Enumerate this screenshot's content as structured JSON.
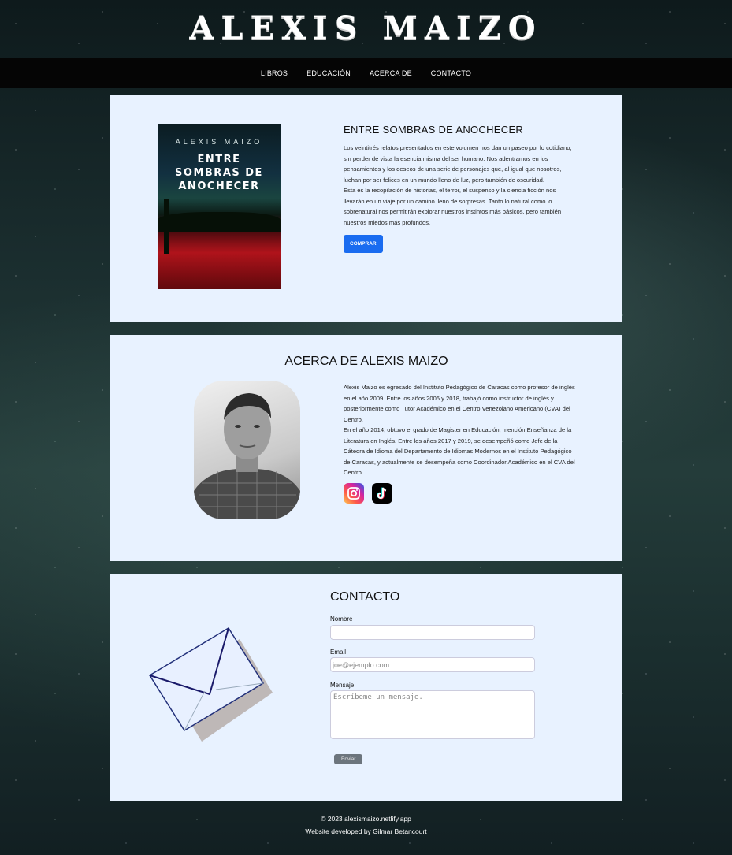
{
  "header": {
    "title": "ALEXIS MAIZO"
  },
  "nav": {
    "items": [
      "LIBROS",
      "EDUCACIÓN",
      "ACERCA DE",
      "CONTACTO"
    ]
  },
  "book": {
    "cover_author": "ALEXIS MAIZO",
    "cover_title": "ENTRE SOMBRAS DE ANOCHECER",
    "heading": "ENTRE SOMBRAS DE ANOCHECER",
    "paragraph1": "Los veintitrés relatos presentados en este volumen nos dan un paseo por lo cotidiano, sin perder de vista la esencia misma del ser humano. Nos adentramos en los pensamientos y los deseos de una serie de personajes que, al igual que nosotros, luchan por ser felices en un mundo lleno de luz, pero también de oscuridad.",
    "paragraph2": "Esta es la recopilación de historias, el terror, el suspenso y la ciencia ficción nos llevarán en un viaje por un camino lleno de sorpresas. Tanto lo natural como lo sobrenatural nos permitirán explorar nuestros instintos más básicos, pero también nuestros miedos más profundos.",
    "buy_label": "COMPRAR"
  },
  "about": {
    "heading": "ACERCA DE ALEXIS MAIZO",
    "paragraph1": "Alexis Maizo es egresado del Instituto Pedagógico de Caracas como profesor de inglés en el año 2009. Entre los años 2006 y 2018, trabajó como instructor de inglés y posteriormente como Tutor Académico en el Centro Venezolano Americano (CVA) del Centro.",
    "paragraph2": "En el año 2014, obtuvo el grado de Magister en Educación, mención Enseñanza de la Literatura en Inglés. Entre los años 2017 y 2019, se desempeñó como Jefe de la Cátedra de Idioma del Departamento de Idiomas Modernos en el Instituto Pedagógico de Caracas, y actualmente se desempeña como Coordinador Académico en el CVA del Centro."
  },
  "contact": {
    "heading": "CONTACTO",
    "name_label": "Nombre",
    "name_value": "",
    "email_label": "Email",
    "email_placeholder": "joe@ejemplo.com",
    "message_label": "Mensaje",
    "message_placeholder": "Escríbeme un mensaje.",
    "send_label": "Enviar"
  },
  "footer": {
    "copyright": "© 2023 alexismaizo.netlify.app",
    "credit": "Website developed by Gilmar Betancourt"
  },
  "colors": {
    "panel": "#e8f2ff",
    "primary_button": "#1a6cf0",
    "nav_bg": "#050505"
  },
  "icons": [
    "instagram-icon",
    "tiktok-icon",
    "envelope-icon"
  ]
}
